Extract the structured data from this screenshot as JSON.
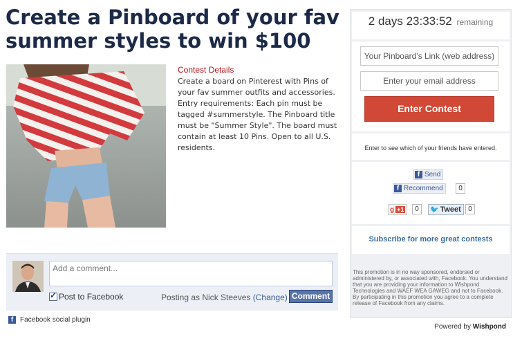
{
  "title": "Create a Pinboard of your fav summer styles to win $100",
  "contest": {
    "heading": "Contest Details",
    "body": "Create a board on Pinterest with Pins of your fav summer outfits and accessories. Entry requirements: Each pin must be tagged #summerstyle. The Pinboard title must be \"Summer Style\". The board must contain at least 10 Pins. Open to all U.S. residents."
  },
  "countdown": {
    "time": "2 days 23:33:52",
    "label": "remaining"
  },
  "form": {
    "pinboard_placeholder": "Your Pinboard's Link (web address)",
    "email_placeholder": "Enter your email address",
    "enter_button": "Enter Contest"
  },
  "friends_note": "Enter to see which of your friends have entered.",
  "social": {
    "send_label": "Send",
    "recommend_label": "Recommend",
    "recommend_count": "0",
    "gplus_label": "+1",
    "gplus_count": "0",
    "tweet_label": "Tweet",
    "tweet_count": "0"
  },
  "subscribe": "Subscribe for more great contests",
  "disclaimer": "This promotion is in no way sponsored, endorsed or administered by, or associated with, Facebook. You understand that you are providing your information to Wishpond Technologies and WAEF WEA GAWEG and not to Facebook. By participating in this promotion you agree to a complete release of Facebook from any claims.",
  "powered": {
    "prefix": "Powered by",
    "brand": "Wishpond"
  },
  "comments": {
    "placeholder": "Add a comment...",
    "post_to_facebook": "Post to Facebook",
    "posting_as": "Posting as Nick Steeves",
    "change_link": "(Change)",
    "comment_button": "Comment",
    "social_plugin": "Facebook social plugin"
  },
  "colors": {
    "title": "#1c2a47",
    "accent_red": "#d14836",
    "facebook_blue": "#3b5998"
  }
}
